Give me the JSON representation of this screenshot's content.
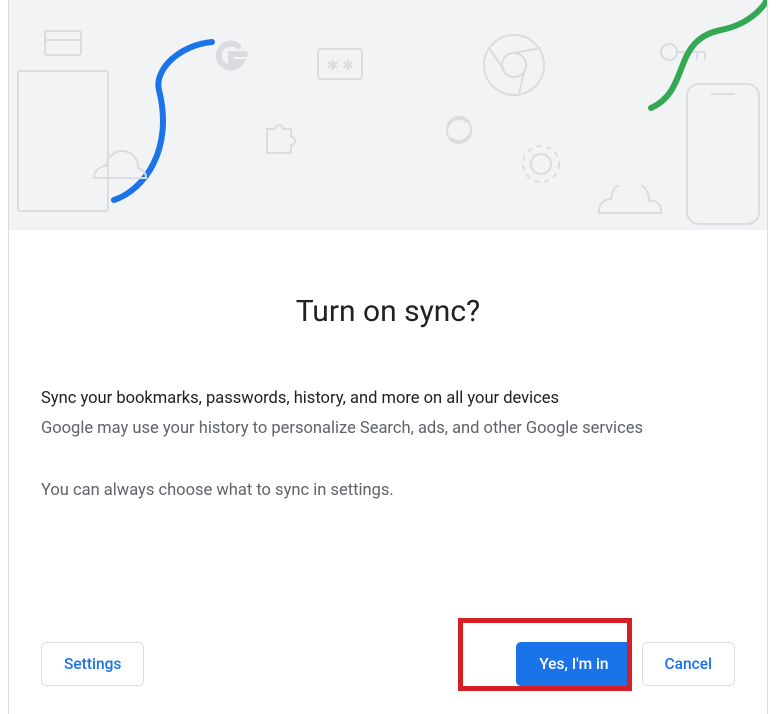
{
  "title": "Turn on sync?",
  "body": {
    "line1": "Sync your bookmarks, passwords, history, and more on all your devices",
    "line2": "Google may use your history to personalize Search, ads, and other Google services",
    "line3": "You can always choose what to sync in settings."
  },
  "buttons": {
    "settings": "Settings",
    "confirm": "Yes, I'm in",
    "cancel": "Cancel"
  },
  "colors": {
    "primary": "#1a73e8",
    "textPrimary": "#202124",
    "textSecondary": "#5f6368",
    "highlight": "#d62027",
    "accentGreen": "#34a853",
    "heroBg": "#f1f3f4"
  }
}
